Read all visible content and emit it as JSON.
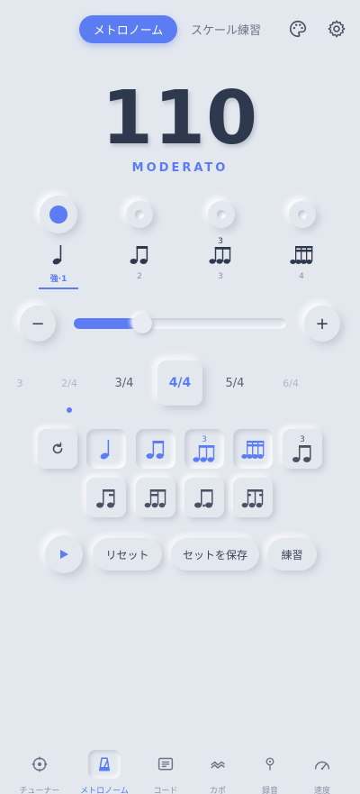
{
  "top_tabs": {
    "active": "メトロノーム",
    "inactive": "スケール練習"
  },
  "icons": {
    "palette": "palette-icon",
    "settings": "gear-icon"
  },
  "bpm": "110",
  "tempo_marking": "MODERATO",
  "beats": [
    {
      "label": "強·1",
      "active": true
    },
    {
      "label": "2",
      "active": false
    },
    {
      "label": "3",
      "active": false
    },
    {
      "label": "4",
      "active": false
    }
  ],
  "slider": {
    "minus": "−",
    "plus": "+",
    "fill_fraction": 0.32
  },
  "time_signatures": {
    "far_left": "3",
    "left": "2/4",
    "prev": "3/4",
    "active": "4/4",
    "next": "5/4",
    "right": "6/4"
  },
  "rhythm_triplet_mark": "3",
  "actions": {
    "reset": "リセット",
    "save": "セットを保存",
    "practice": "練習"
  },
  "bottom_nav": [
    {
      "label": "チューナー",
      "icon": "tuner-icon",
      "active": false
    },
    {
      "label": "メトロノーム",
      "icon": "metronome-icon",
      "active": true
    },
    {
      "label": "コード",
      "icon": "chord-icon",
      "active": false
    },
    {
      "label": "カポ",
      "icon": "capo-icon",
      "active": false
    },
    {
      "label": "録音",
      "icon": "mic-icon",
      "active": false
    },
    {
      "label": "速度",
      "icon": "speed-icon",
      "active": false
    }
  ],
  "colors": {
    "accent": "#5b7cf2",
    "background": "#e3e7ee",
    "text": "#2e394d"
  }
}
